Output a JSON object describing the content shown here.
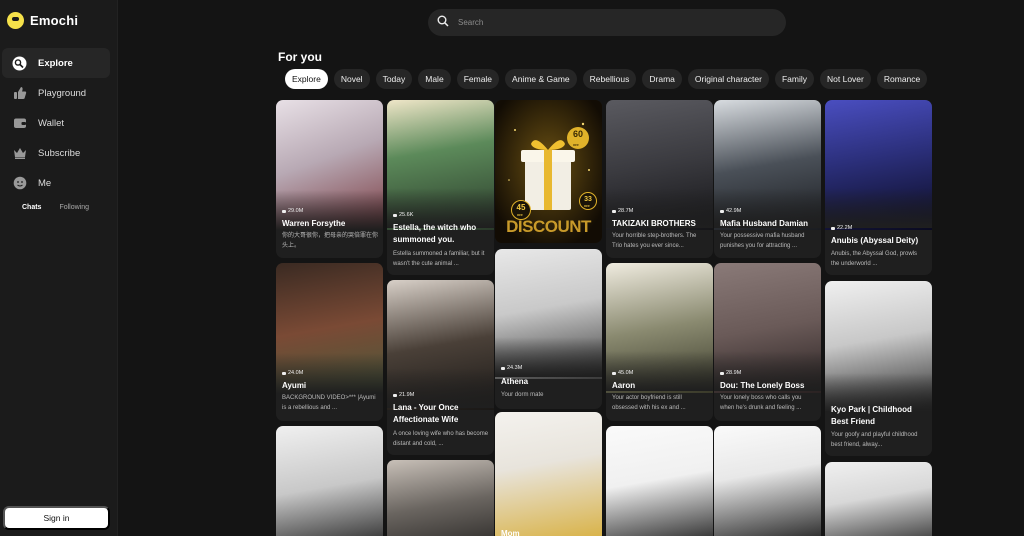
{
  "brand": {
    "name": "Emochi",
    "accent": "#f5e14a"
  },
  "sidebar": {
    "items": [
      {
        "label": "Explore",
        "icon": "explore-icon",
        "active": true
      },
      {
        "label": "Playground",
        "icon": "thumbs-up-icon"
      },
      {
        "label": "Wallet",
        "icon": "wallet-icon"
      },
      {
        "label": "Subscribe",
        "icon": "crown-icon"
      },
      {
        "label": "Me",
        "icon": "face-icon"
      }
    ],
    "subtabs": [
      "Chats",
      "Following"
    ],
    "signin": "Sign in"
  },
  "search": {
    "placeholder": "Search"
  },
  "section_title": "For you",
  "categories": [
    "Explore",
    "Novel",
    "Today",
    "Male",
    "Female",
    "Anime & Game",
    "Rebellious",
    "Drama",
    "Original character",
    "Family",
    "Not Lover",
    "Romance"
  ],
  "promo": {
    "badge_top": "60",
    "badge_top_sub": "OFF",
    "badge_left": "45",
    "badge_left_sub": "OFF",
    "badge_right": "33",
    "badge_right_sub": "OFF",
    "word": "DISCOUNT"
  },
  "cards": [
    {
      "views": "29.0M",
      "name": "Warren Forsythe",
      "desc": "你的大哥很你，把母亲的哭倍罪在你头上。",
      "color": "#b8a9b4"
    },
    {
      "views": "25.6K",
      "name": "Estella, the witch who summoned you.",
      "desc": "Estella summoned a familiar, but it wasn't the cute animal ...",
      "color": "#5c8a5a"
    },
    {
      "views": "28.7M",
      "name": "TAKIZAKI BROTHERS",
      "desc": "Your horrible step-brothers. The Trio hates you ever since...",
      "color": "#3a3a3f"
    },
    {
      "views": "42.9M",
      "name": "Mafia Husband Damian",
      "desc": "Your possessive mafia husband punishes you for attracting ...",
      "color": "#4a5058"
    },
    {
      "views": "22.2M",
      "name": "Anubis (Abyssal Deity)",
      "desc": "Anubis, the Abyssal God, prowls the underworld ...",
      "color": "#2b2f7a"
    },
    {
      "views": "24.0M",
      "name": "Ayumi",
      "desc": "BACKGROUND VIDEO>*** |Ayumi is a rebellious and ...",
      "color": "#7a4a35"
    },
    {
      "views": "24.3M",
      "name": "Athena",
      "desc": "Your dorm mate",
      "color": "#c9c9c9"
    },
    {
      "views": "45.0M",
      "name": "Aaron",
      "desc": "Your actor boyfriend is still obsessed with his ex and ...",
      "color": "#8a8a70"
    },
    {
      "views": "28.9M",
      "name": "Dou: The Lonely Boss",
      "desc": "Your lonely boss who calls you when he's drunk and feeling ...",
      "color": "#6a5a58"
    },
    {
      "views": "21.9M",
      "name": "Lana - Your Once Affectionate Wife",
      "desc": "A once loving wife who has become distant and cold, ...",
      "color": "#4a4038"
    },
    {
      "views": "",
      "name": "Kyo Park | Childhood Best Friend",
      "desc": "Your goofy and playful childhood best friend, alway...",
      "color": "#c8c8c8"
    },
    {
      "views": "",
      "name": "",
      "desc": "",
      "color": "#9a9590"
    },
    {
      "views": "",
      "name": "",
      "desc": "",
      "color": "#6a6560"
    },
    {
      "views": "",
      "name": "Mom",
      "desc": "",
      "color": "#e8e4dc"
    },
    {
      "views": "",
      "name": "",
      "desc": "",
      "color": "#f0f0f0"
    },
    {
      "views": "",
      "name": "",
      "desc": "",
      "color": "#e8e8e8"
    },
    {
      "views": "",
      "name": "",
      "desc": "",
      "color": "#d8d8d8"
    }
  ]
}
